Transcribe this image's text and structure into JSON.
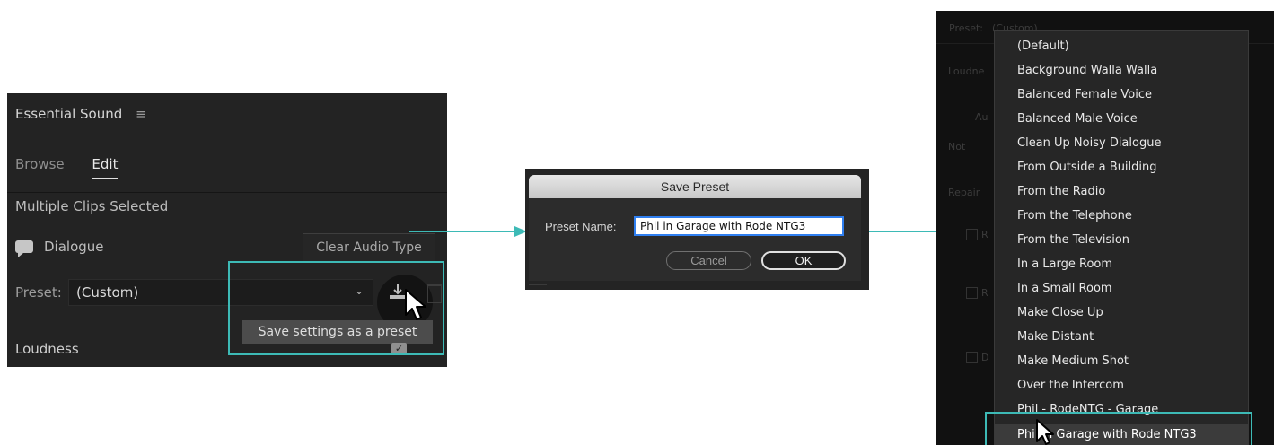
{
  "panel1": {
    "title": "Essential Sound",
    "menu_icon": "≡",
    "tabs": [
      {
        "label": "Browse",
        "active": false
      },
      {
        "label": "Edit",
        "active": true
      }
    ],
    "selection_label": "Multiple Clips Selected",
    "audio_type": "Dialogue",
    "clear_button": "Clear Audio Type",
    "preset_label": "Preset:",
    "preset_value": "(Custom)",
    "tooltip": "Save settings as a preset",
    "section_label": "Loudness",
    "icons": [
      "speech-bubble-icon",
      "chevron-down-icon",
      "save-preset-icon",
      "trash-icon",
      "checkbox-icon",
      "cursor-icon"
    ]
  },
  "dialog": {
    "title": "Save Preset",
    "field_label": "Preset Name:",
    "field_value": "Phil in Garage with Rode NTG3",
    "cancel_label": "Cancel",
    "ok_label": "OK"
  },
  "dropdown": {
    "background_labels": [
      "Preset:",
      "(Custom)",
      "Loudne",
      "Au",
      "Not",
      "Repair",
      "R",
      "R",
      "D"
    ],
    "items": [
      "(Default)",
      "Background Walla Walla",
      "Balanced Female Voice",
      "Balanced Male Voice",
      "Clean Up Noisy Dialogue",
      "From Outside a Building",
      "From the Radio",
      "From the Telephone",
      "From the Television",
      "In a Large Room",
      "In a Small Room",
      "Make Close Up",
      "Make Distant",
      "Make Medium Shot",
      "Over the Intercom",
      "Phil - RodeNTG - Garage",
      "Phil in Garage with Rode NTG3"
    ],
    "selected_index": 16
  },
  "colors": {
    "accent_teal": "#3dbab6",
    "panel_bg": "#232323",
    "focus_blue": "#2f7ff0"
  }
}
